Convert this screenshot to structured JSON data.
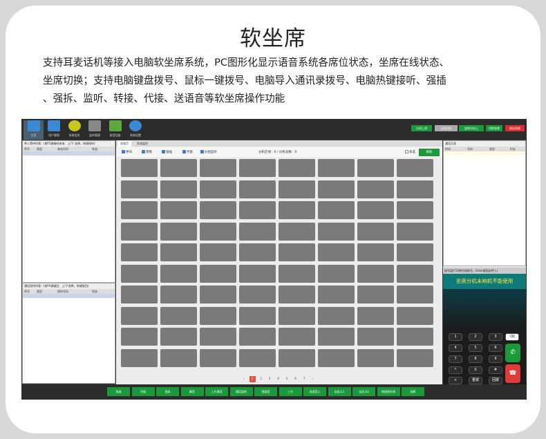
{
  "headline": "软坐席",
  "description": [
    "支持耳麦话机等接入电脑软坐席系统，PC图形化显示语音系统各席位状态，坐席在线状态、",
    "坐席切换；支持电脑键盘拨号、鼠标一键拨号、电脑导入通讯录拨号、电脑热键接听、强插",
    "、强拆、监听、转接、代接、送语音等软坐席操作功能"
  ],
  "app": {
    "toolbar": [
      {
        "label": "主页",
        "icon": "home-icon",
        "color": "#3a8ad8"
      },
      {
        "label": "用户管理",
        "icon": "users-icon",
        "color": "#3a8ad8"
      },
      {
        "label": "系统信息",
        "icon": "info-icon",
        "color": "#c8c81a"
      },
      {
        "label": "监听管理",
        "icon": "monitor-icon",
        "color": "#888888"
      },
      {
        "label": "录音回放",
        "icon": "recording-icon",
        "color": "#5aaa3a"
      },
      {
        "label": "系统设置",
        "icon": "gear-icon",
        "color": "#3a8ad8"
      }
    ],
    "top_right_buttons": [
      {
        "label": "分机上线",
        "color": "#1a9a3a"
      },
      {
        "label": "全部分机",
        "color": "#aaaaaa"
      },
      {
        "label": "监听分机上",
        "color": "#1a9a3a"
      },
      {
        "label": "切换坐席",
        "color": "#1a9a3a"
      },
      {
        "label": "退出系统",
        "color": "#d83030"
      }
    ],
    "left_top": {
      "header": "呼入等待列表：(按F5键接听来电：上/下 选择，热键接听)",
      "columns": [
        "序号",
        "类型",
        "来电号码",
        "状态"
      ]
    },
    "left_bottom": {
      "header": "通话保持列表：(按F6键接回：上/下选择，热键接回)",
      "columns": [
        "序号",
        "类型",
        "保持号码",
        "状态"
      ]
    },
    "tabs": [
      "坐席页",
      "状态监控"
    ],
    "center_tools": [
      {
        "label": "呼叫",
        "color": "#3a7ad8"
      },
      {
        "label": "转接",
        "color": "#3a7ad8"
      },
      {
        "label": "强插",
        "color": "#3a7ad8"
      },
      {
        "label": "代接",
        "color": "#3a7ad8"
      },
      {
        "label": "分组监听",
        "color": "#3a7ad8"
      }
    ],
    "center_status": "分机在线：6 / 分机总数：9",
    "multi_select_label": "多选",
    "refresh_label": "刷新",
    "pages": [
      "‹",
      "1",
      "2",
      "3",
      "4",
      "5",
      "6",
      "7",
      "›"
    ],
    "current_page": "1",
    "seat_grid": {
      "rows": 10,
      "cols": 8
    },
    "call_log": {
      "header": "通话记录",
      "columns": [
        "时间",
        "号码",
        "类型",
        "时长"
      ]
    },
    "keypad": {
      "header": "拨号盘(F10转外线拨号，Enter键发起呼入)",
      "info": "坐席分机未响机不能使用",
      "keys": [
        [
          "1",
          "2",
          "3",
          "⌫"
        ],
        [
          "4",
          "5",
          "6"
        ],
        [
          "7",
          "8",
          "9"
        ],
        [
          "*",
          "0",
          "#"
        ],
        [
          "+",
          "重拨",
          "回拨"
        ]
      ],
      "answer_icon": "phone-answer-icon",
      "hangup_icon": "phone-hangup-icon"
    },
    "bottom_buttons": [
      "强插",
      "代接",
      "强拆",
      "静音",
      "上方通话",
      "通话监听",
      "强插音",
      "三方",
      "送语音入",
      "自定义1",
      "自定义2",
      "转接到外线",
      "挂断"
    ]
  }
}
